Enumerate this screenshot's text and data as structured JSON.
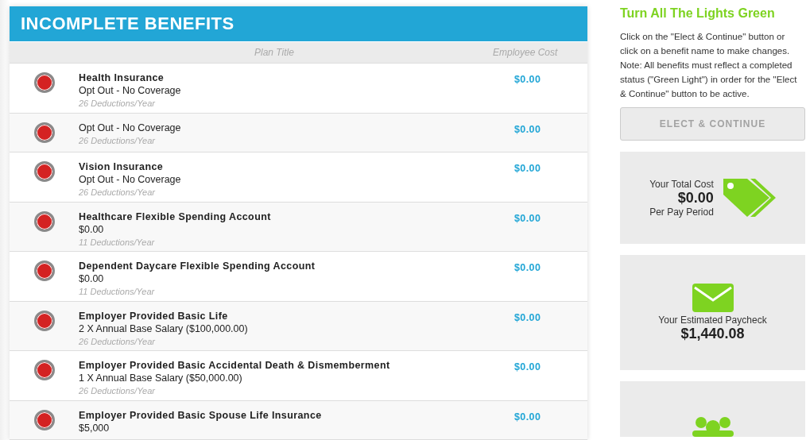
{
  "panel": {
    "title": "INCOMPLETE BENEFITS",
    "columns": [
      "Plan Title",
      "Employee Cost"
    ],
    "rows": [
      {
        "title": "Health Insurance",
        "detail": "Opt Out - No Coverage",
        "deductions": "26 Deductions/Year",
        "cost": "$0.00",
        "color": "#d42222"
      },
      {
        "detail": "Opt Out - No Coverage",
        "deductions": "26 Deductions/Year",
        "cost": "$0.00",
        "color": "#d42222"
      },
      {
        "title": "Vision Insurance",
        "detail": "Opt Out - No Coverage",
        "deductions": "26 Deductions/Year",
        "cost": "$0.00",
        "color": "#d42222"
      },
      {
        "title": "Healthcare Flexible Spending Account",
        "detail": "$0.00",
        "deductions": "11 Deductions/Year",
        "cost": "$0.00",
        "color": "#d42222"
      },
      {
        "title": "Dependent Daycare Flexible Spending Account",
        "detail": "$0.00",
        "deductions": "11 Deductions/Year",
        "cost": "$0.00",
        "color": "#d42222"
      },
      {
        "title": "Employer Provided Basic Life",
        "detail": "2 X Annual Base Salary ($100,000.00)",
        "deductions": "26 Deductions/Year",
        "cost": "$0.00",
        "color": "#d42222"
      },
      {
        "title": "Employer Provided Basic Accidental Death & Dismemberment",
        "detail": "1 X Annual Base Salary ($50,000.00)",
        "deductions": "26 Deductions/Year",
        "cost": "$0.00",
        "color": "#d42222"
      },
      {
        "title": "Employer Provided Basic Spouse Life Insurance",
        "detail": "$5,000",
        "cost": "$0.00",
        "color": "#d42222"
      }
    ]
  },
  "sidebar": {
    "heading": "Turn All The Lights Green",
    "text": "Click on the \"Elect & Continue\" button or click on a benefit name to make changes. Note: All benefits must reflect a completed status (\"Green Light\") in order for the \"Elect & Continue\" button to be active.",
    "button": {
      "label": "ELECT & CONTINUE",
      "disabled": true
    },
    "cards": [
      {
        "kind": "cost",
        "label": "Your Total Cost",
        "value": "$0.00",
        "note": "Per Pay Period"
      },
      {
        "kind": "paycheck",
        "label": "Your Estimated Paycheck",
        "value": "$1,440.08"
      },
      {
        "kind": "people"
      }
    ]
  }
}
